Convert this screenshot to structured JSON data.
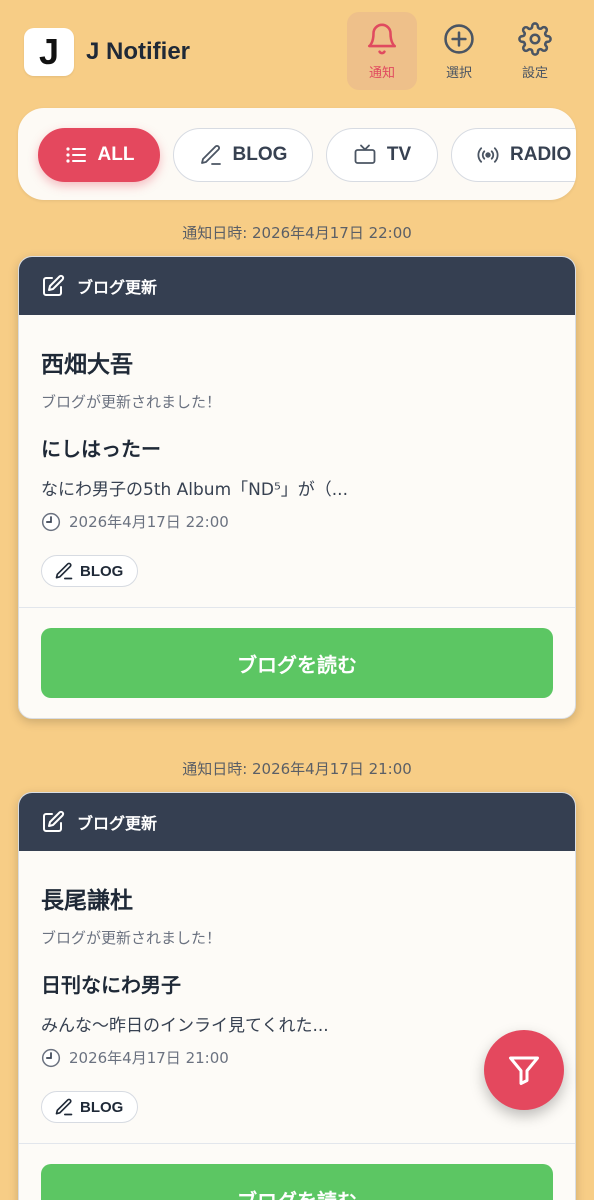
{
  "app": {
    "logo_letter": "J",
    "title": "J Notifier"
  },
  "nav": [
    {
      "label": "通知",
      "icon": "bell-icon",
      "active": true
    },
    {
      "label": "選択",
      "icon": "plus-circle-icon",
      "active": false
    },
    {
      "label": "設定",
      "icon": "gear-icon",
      "active": false
    }
  ],
  "filters": [
    {
      "label": "ALL",
      "icon": "list-icon",
      "active": true
    },
    {
      "label": "BLOG",
      "icon": "pencil-icon",
      "active": false
    },
    {
      "label": "TV",
      "icon": "tv-icon",
      "active": false
    },
    {
      "label": "RADIO",
      "icon": "radio-icon",
      "active": false
    }
  ],
  "notifications": [
    {
      "notified_at": "通知日時: 2026年4月17日 22:00",
      "category": "ブログ更新",
      "member": "西畑大吾",
      "subtitle": "ブログが更新されました！",
      "post_title": "にしはったー",
      "excerpt": "なにわ男子の5th Album「ND⁵」が（...",
      "date": "2026年4月17日 22:00",
      "tag": "BLOG",
      "action": "ブログを読む"
    },
    {
      "notified_at": "通知日時: 2026年4月17日 21:00",
      "category": "ブログ更新",
      "member": "長尾謙杜",
      "subtitle": "ブログが更新されました！",
      "post_title": "日刊なにわ男子",
      "excerpt": "みんな〜昨日のインライ見てくれた...",
      "date": "2026年4月17日 21:00",
      "tag": "BLOG",
      "action": "ブログを読む"
    }
  ],
  "colors": {
    "background": "#f7cd86",
    "accent": "#e4485e",
    "card_header": "#353f51",
    "action": "#5cc663"
  },
  "fab": {
    "icon": "filter-icon"
  }
}
